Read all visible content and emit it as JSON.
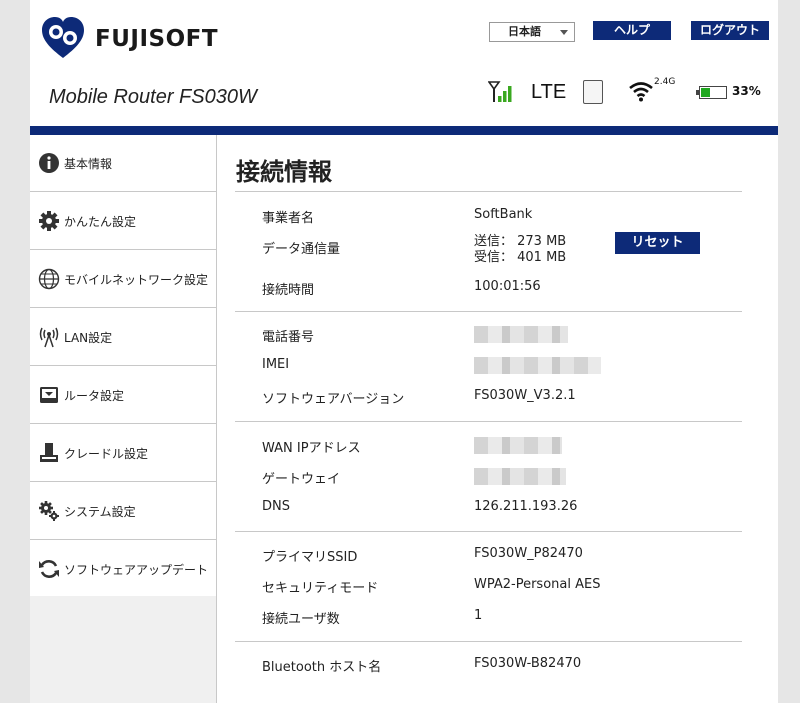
{
  "header": {
    "brand": "FUJISOFT",
    "model": "Mobile Router FS030W",
    "language": "日本語",
    "help_label": "ヘルプ",
    "logout_label": "ログアウト",
    "status": {
      "network_type": "LTE",
      "wifi_band": "2.4G",
      "battery_percent": "33%",
      "battery_level": 0.33,
      "signal_bars": 3
    }
  },
  "sidebar": {
    "items": [
      {
        "label": "基本情報",
        "icon": "info-icon"
      },
      {
        "label": "かんたん設定",
        "icon": "gear-icon"
      },
      {
        "label": "モバイルネットワーク設定",
        "icon": "globe-icon"
      },
      {
        "label": "LAN設定",
        "icon": "antenna-icon"
      },
      {
        "label": "ルータ設定",
        "icon": "router-icon"
      },
      {
        "label": "クレードル設定",
        "icon": "cradle-icon"
      },
      {
        "label": "システム設定",
        "icon": "gears-icon"
      },
      {
        "label": "ソフトウェアアップデート",
        "icon": "refresh-icon"
      }
    ]
  },
  "main": {
    "title": "接続情報",
    "reset_label": "リセット",
    "rows": {
      "carrier": {
        "label": "事業者名",
        "value": "SoftBank"
      },
      "data_usage": {
        "label": "データ通信量",
        "sent": "送信： 273 MB",
        "received": "受信： 401 MB"
      },
      "connection_time": {
        "label": "接続時間",
        "value": "100:01:56"
      },
      "phone_number": {
        "label": "電話番号"
      },
      "imei": {
        "label": "IMEI"
      },
      "software_version": {
        "label": "ソフトウェアバージョン",
        "value": "FS030W_V3.2.1"
      },
      "wan_ip": {
        "label": "WAN IPアドレス"
      },
      "gateway": {
        "label": "ゲートウェイ"
      },
      "dns": {
        "label": "DNS",
        "value": "126.211.193.26"
      },
      "primary_ssid": {
        "label": "プライマリSSID",
        "value": "FS030W_P82470"
      },
      "security_mode": {
        "label": "セキュリティモード",
        "value": "WPA2-Personal AES"
      },
      "connected_users": {
        "label": "接続ユーザ数",
        "value": "1"
      },
      "bluetooth_host": {
        "label": "Bluetooth ホスト名",
        "value": "FS030W-B82470"
      }
    }
  },
  "colors": {
    "brand_blue": "#0d2a78",
    "battery_green": "#1fa81f",
    "signal_green": "#3aa820"
  }
}
